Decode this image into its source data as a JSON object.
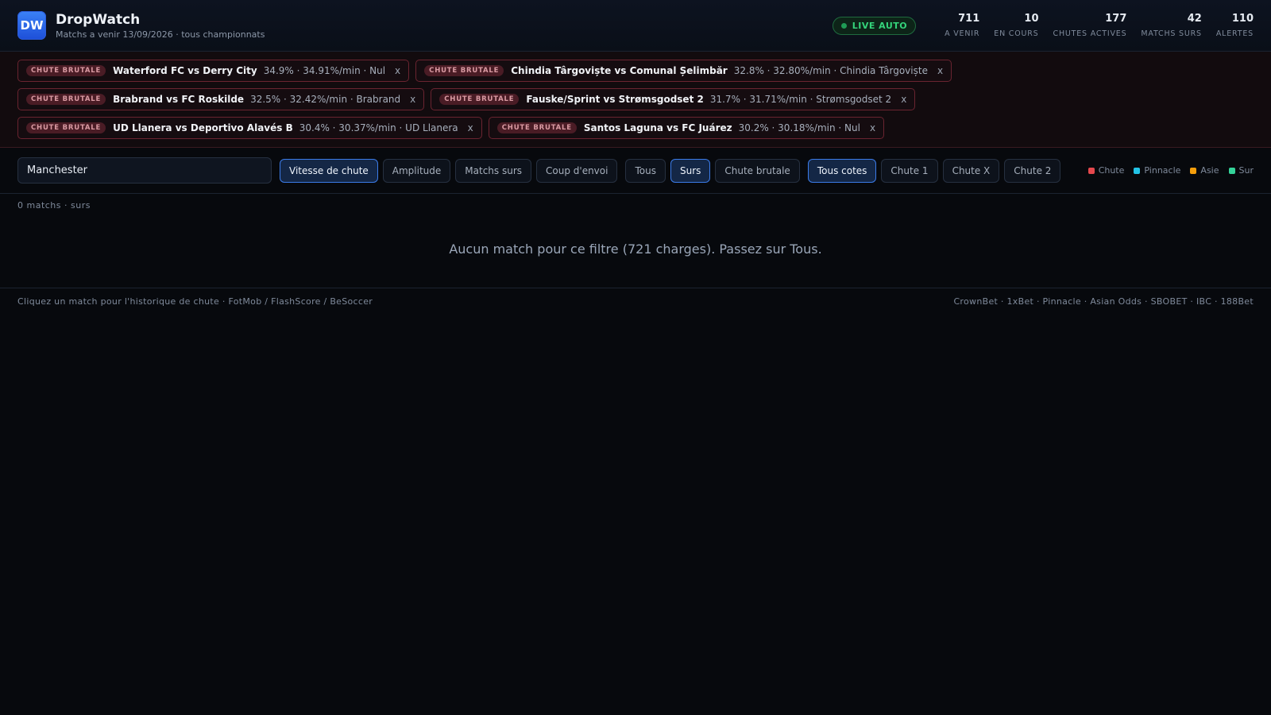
{
  "header": {
    "logo": "DW",
    "title": "DropWatch",
    "subtitle": "Matchs a venir 13/09/2026 · tous championnats",
    "live_badge": "LIVE AUTO",
    "stats": [
      {
        "value": "711",
        "label": "A VENIR"
      },
      {
        "value": "10",
        "label": "EN COURS"
      },
      {
        "value": "177",
        "label": "CHUTES ACTIVES"
      },
      {
        "value": "42",
        "label": "MATCHS SURS"
      },
      {
        "value": "110",
        "label": "ALERTES"
      }
    ]
  },
  "alerts": [
    {
      "tag": "CHUTE BRUTALE",
      "match": "Waterford FC vs Derry City",
      "detail": "34.9% · 34.91%/min · Nul",
      "close": "x"
    },
    {
      "tag": "CHUTE BRUTALE",
      "match": "Chindia Târgoviște vs Comunal Șelimbăr",
      "detail": "32.8% · 32.80%/min · Chindia Târgoviște",
      "close": "x"
    },
    {
      "tag": "CHUTE BRUTALE",
      "match": "Brabrand vs FC Roskilde",
      "detail": "32.5% · 32.42%/min · Brabrand",
      "close": "x"
    },
    {
      "tag": "CHUTE BRUTALE",
      "match": "Fauske/Sprint vs Strømsgodset 2",
      "detail": "31.7% · 31.71%/min · Strømsgodset 2",
      "close": "x"
    },
    {
      "tag": "CHUTE BRUTALE",
      "match": "UD Llanera vs Deportivo Alavés B",
      "detail": "30.4% · 30.37%/min · UD Llanera",
      "close": "x"
    },
    {
      "tag": "CHUTE BRUTALE",
      "match": "Santos Laguna vs FC Juárez",
      "detail": "30.2% · 30.18%/min · Nul",
      "close": "x"
    }
  ],
  "toolbar": {
    "search_value": "Manchester",
    "sort_buttons": [
      "Vitesse de chute",
      "Amplitude",
      "Matchs surs",
      "Coup d'envoi"
    ],
    "filter_buttons": [
      "Tous",
      "Surs",
      "Chute brutale"
    ],
    "odds_buttons": [
      "Tous cotes",
      "Chute 1",
      "Chute X",
      "Chute 2"
    ],
    "legend": [
      {
        "label": "Chute",
        "color": "#e5484d"
      },
      {
        "label": "Pinnacle",
        "color": "#22c3e6"
      },
      {
        "label": "Asie",
        "color": "#f59e0b"
      },
      {
        "label": "Sur",
        "color": "#34d399"
      }
    ]
  },
  "main": {
    "count_line": "0 matchs · surs",
    "empty_message": "Aucun match pour ce filtre (721 charges). Passez sur Tous."
  },
  "footer": {
    "left": "Cliquez un match pour l'historique de chute · FotMob / FlashScore / BeSoccer",
    "right": "CrownBet · 1xBet · Pinnacle · Asian Odds · SBOBET · IBC · 188Bet"
  }
}
